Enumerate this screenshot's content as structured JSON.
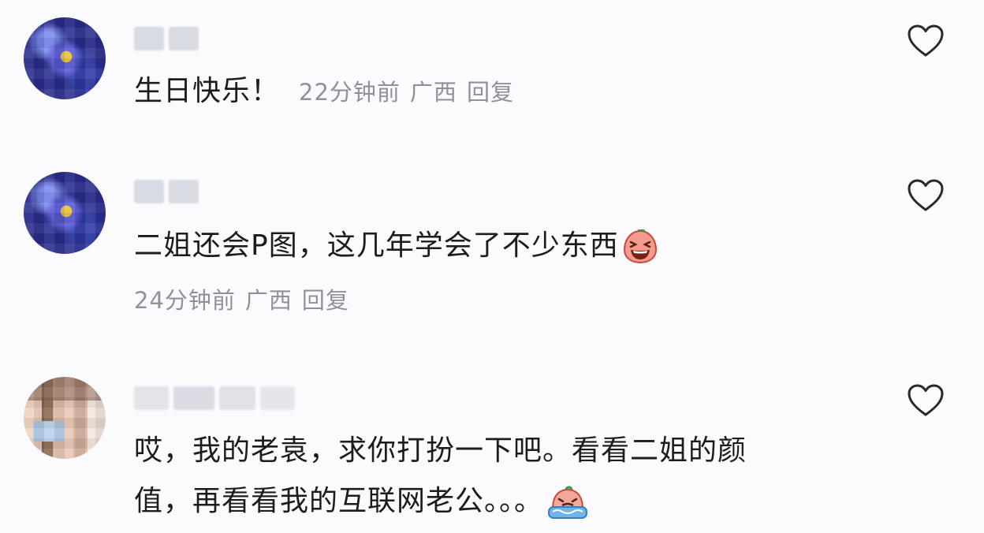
{
  "comments": [
    {
      "text": "生日快乐！",
      "time": "22分钟前",
      "location": "广西",
      "reply_label": "回复"
    },
    {
      "text": "二姐还会P图，这几年学会了不少东西",
      "time": "24分钟前",
      "location": "广西",
      "reply_label": "回复",
      "emoji": "laughing-emoji"
    },
    {
      "text_line1": "哎，我的老袁，求你打扮一下吧。看看二姐的颜",
      "text_line2": "值，再看看我的互联网老公。。。",
      "emoji": "crying-emoji"
    }
  ],
  "colors": {
    "background": "#fbfbfd",
    "text": "#1c1c1e",
    "meta": "#8f919a",
    "heart": "#2a2a2e"
  }
}
